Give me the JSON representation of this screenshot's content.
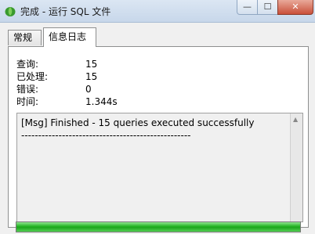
{
  "window": {
    "title": "完成 - 运行 SQL 文件",
    "icon": "navicat-leaf-icon",
    "minimize_glyph": "—",
    "maximize_glyph": "☐",
    "close_glyph": "✕"
  },
  "tabs": [
    {
      "label": "常规",
      "active": false
    },
    {
      "label": "信息日志",
      "active": true
    }
  ],
  "stats": {
    "query_label": "查询:",
    "query_value": "15",
    "processed_label": "已处理:",
    "processed_value": "15",
    "errors_label": "错误:",
    "errors_value": "0",
    "time_label": "时间:",
    "time_value": "1.344s"
  },
  "log": {
    "text": "[Msg] Finished - 15 queries executed successfully\n--------------------------------------------------"
  },
  "progress": {
    "fraction": 1.0,
    "color": "#22b322"
  }
}
